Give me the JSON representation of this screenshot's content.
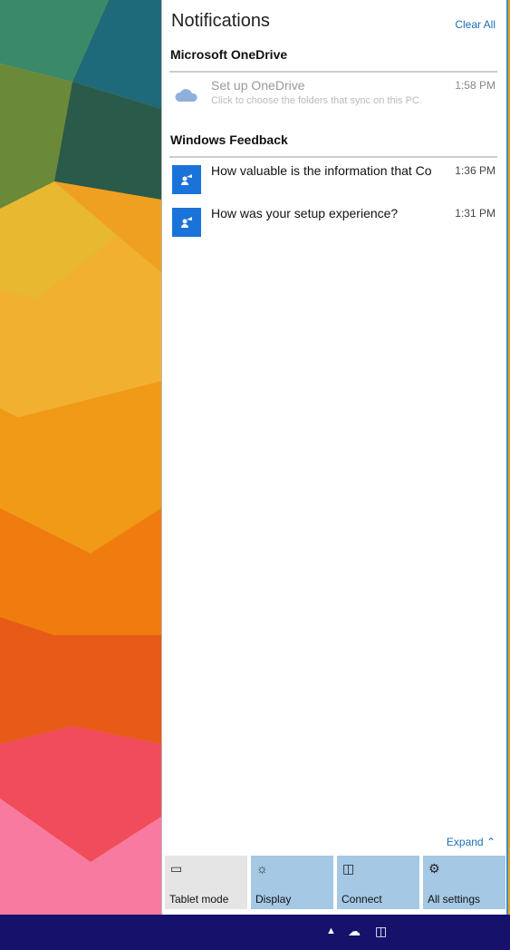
{
  "panel": {
    "title": "Notifications",
    "clear_all": "Clear All",
    "expand": "Expand"
  },
  "groups": [
    {
      "name": "Microsoft OneDrive",
      "items": [
        {
          "title": "Set up OneDrive",
          "subtitle": "Click to choose the folders that sync on this PC.",
          "time": "1:58 PM",
          "icon": "onedrive-cloud-icon"
        }
      ]
    },
    {
      "name": "Windows Feedback",
      "items": [
        {
          "title": "How valuable is the information that Co",
          "time": "1:36 PM",
          "icon": "feedback-icon"
        },
        {
          "title": "How was your setup experience?",
          "time": "1:31 PM",
          "icon": "feedback-icon"
        }
      ]
    }
  ],
  "quick_actions": [
    {
      "label": "Tablet mode",
      "icon": "tablet-icon",
      "active": false
    },
    {
      "label": "Display",
      "icon": "brightness-icon",
      "active": true
    },
    {
      "label": "Connect",
      "icon": "connect-icon",
      "active": true
    },
    {
      "label": "All settings",
      "icon": "gear-icon",
      "active": true
    }
  ],
  "colors": {
    "accent": "#1a73d9",
    "tile_active": "#a5c8e5",
    "taskbar": "#16116b"
  }
}
